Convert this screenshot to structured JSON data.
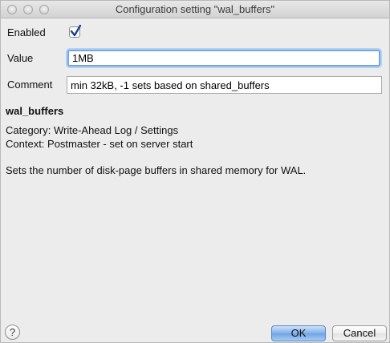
{
  "window": {
    "title": "Configuration setting \"wal_buffers\""
  },
  "form": {
    "enabled_label": "Enabled",
    "enabled_checked": true,
    "value_label": "Value",
    "value": "1MB",
    "comment_label": "Comment",
    "comment": "min 32kB, -1 sets based on shared_buffers"
  },
  "description": {
    "name": "wal_buffers",
    "category": "Category: Write-Ahead Log / Settings",
    "context": "Context: Postmaster - set on server start",
    "text": "Sets the number of disk-page buffers in shared memory for WAL."
  },
  "buttons": {
    "help": "?",
    "ok": "OK",
    "cancel": "Cancel"
  }
}
